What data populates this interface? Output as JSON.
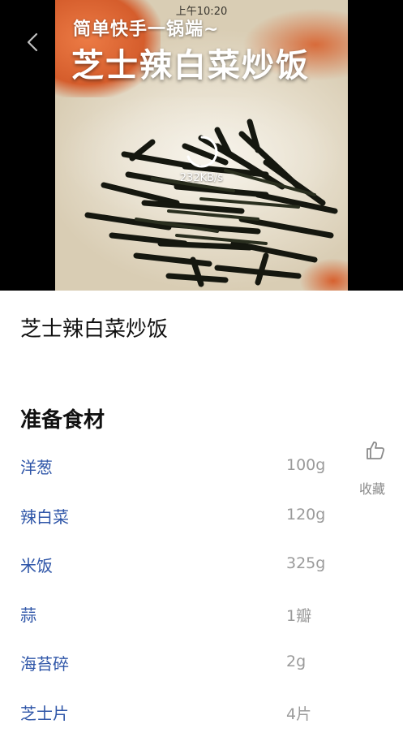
{
  "status_bar": {
    "time": "上午10:20"
  },
  "video": {
    "overlay_subtitle": "简单快手一锅端~",
    "overlay_title": "芝士辣白菜炒饭",
    "loading_speed": "232KB/s"
  },
  "recipe": {
    "title": "芝士辣白菜炒饭"
  },
  "ingredients": {
    "section_title": "准备食材",
    "items": [
      {
        "name": "洋葱",
        "qty": "100g"
      },
      {
        "name": "辣白菜",
        "qty": "120g"
      },
      {
        "name": "米饭",
        "qty": "325g"
      },
      {
        "name": "蒜",
        "qty": "1瓣"
      },
      {
        "name": "海苔碎",
        "qty": "2g"
      },
      {
        "name": "芝士片",
        "qty": "4片"
      }
    ]
  },
  "actions": {
    "favorite_label": "收藏"
  },
  "icons": {
    "back": "chevron-left-icon",
    "favorite": "thumbs-up-icon",
    "loading": "spinner-icon"
  },
  "colors": {
    "ingredient_name": "#2f56a8",
    "quantity": "#9a9a9a",
    "video_bg": "#000000"
  }
}
